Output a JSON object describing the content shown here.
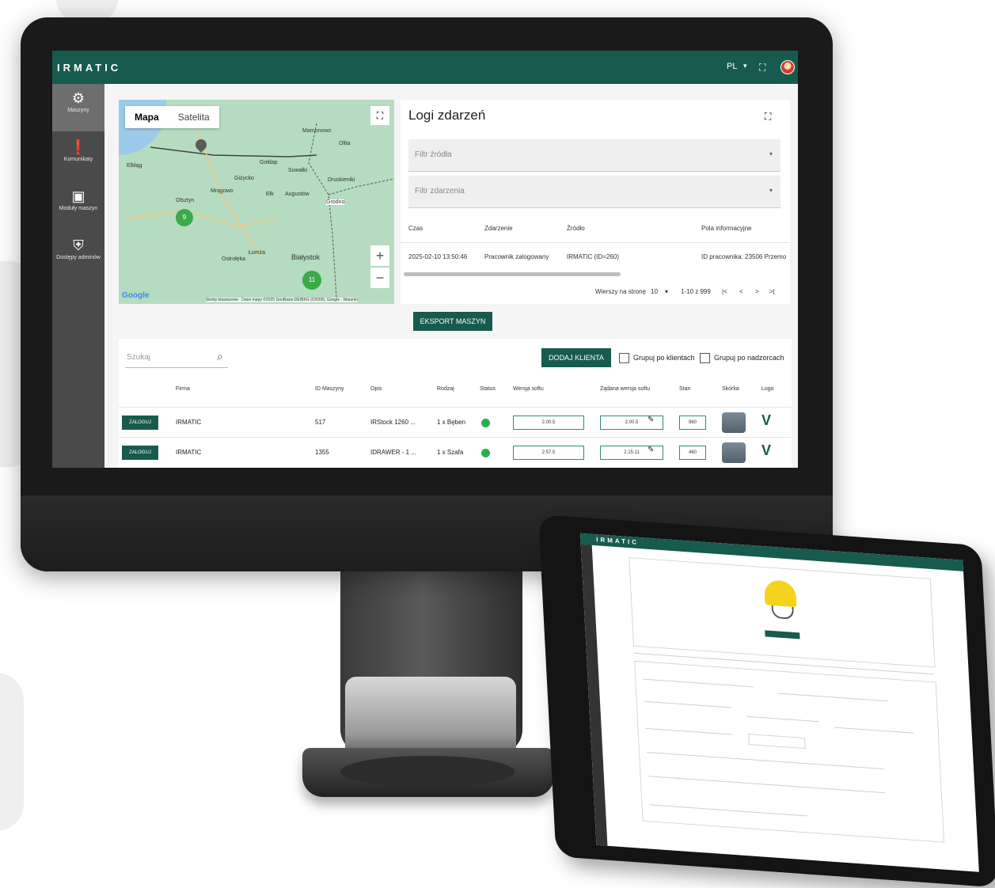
{
  "app": {
    "logo": "IRMATIC",
    "language": "PL",
    "language_caret": "▾",
    "fullscreen_glyph": "⛶"
  },
  "sidebar": {
    "items": [
      {
        "icon": "machines-icon",
        "glyph": "⚙",
        "label": "Maszyny",
        "active": true
      },
      {
        "icon": "alert-icon",
        "glyph": "❗",
        "label": "Komunikaty",
        "active": false
      },
      {
        "icon": "modules-icon",
        "glyph": "▣",
        "label": "Moduły maszyn",
        "active": false
      },
      {
        "icon": "admin-access-icon",
        "glyph": "⛨",
        "label": "Dostępy adminów",
        "active": false
      }
    ]
  },
  "map": {
    "tabs": [
      "Mapa",
      "Satelita"
    ],
    "selected_tab": "Mapa",
    "zoom_in": "+",
    "zoom_out": "−",
    "places": [
      "Elbląg",
      "Olsztyn",
      "Giżycko",
      "Gołdap",
      "Suwałki",
      "Mrągowo",
      "Ełk",
      "Augustów",
      "Łomża",
      "Białystok",
      "Ostrołęka",
      "Grodno",
      "Druskieniki",
      "Mamonowo",
      "Olita"
    ],
    "clusters": [
      "9",
      "11"
    ],
    "attribution": "Skróty klawiszowe · Dane mapy ©2025 GeoBasis-DE/BKG (©2009), Google · Warunki",
    "google_label": "Google"
  },
  "logs": {
    "title": "Logi zdarzeń",
    "filter_source_placeholder": "Filtr źródła",
    "filter_event_placeholder": "Filtr zdarzenia",
    "dropdown_glyph": "▾",
    "columns": [
      "Czas",
      "Zdarzenie",
      "Źródło",
      "Pola informacyjne"
    ],
    "rows": [
      {
        "time": "2025-02-10 13:50:46",
        "event": "Pracownik zalogowany",
        "source": "IRMATIC (ID=260)",
        "info": "ID pracownika: 23506 Przemo"
      }
    ],
    "rows_per_page_label": "Wierszy na stronę",
    "rows_per_page": "10",
    "range": "1-10 z 999",
    "nav_first": "|<",
    "nav_prev": "<",
    "nav_next": ">",
    "nav_last": ">|"
  },
  "export_button": "EKSPORT MASZYN",
  "machines": {
    "search_placeholder": "Szukaj",
    "search_glyph": "⌕",
    "add_client_button": "DODAJ KLIENTA",
    "group_by_clients": "Grupuj po klientach",
    "group_by_supervisors": "Grupuj po nadzorcach",
    "columns": [
      "Firma",
      "ID Maszyny",
      "Opis",
      "Rodzaj",
      "Status",
      "Wersja softu",
      "Żądana wersja softu",
      "Stan",
      "Skórka",
      "Logo"
    ],
    "rows": [
      {
        "login": "ZALOGUJ",
        "company": "IRMATIC",
        "id": "517",
        "desc": "IRStock 1260 ...",
        "type": "1 x Bęben",
        "version": "2.00.5",
        "requested": "2.00.5",
        "state": "960"
      },
      {
        "login": "ZALOGUJ",
        "company": "IRMATIC",
        "id": "1355",
        "desc": "IDRAWER - 1 ...",
        "type": "1 x Szafa",
        "version": "2.57.5",
        "requested": "2.15.11",
        "state": "460"
      }
    ],
    "edit_glyph": "✎",
    "logo_glyph": "V"
  },
  "tablet": {
    "logo": "IRMATIC"
  },
  "colors": {
    "brand": "#175a4e",
    "status_ok": "#22b14c"
  }
}
